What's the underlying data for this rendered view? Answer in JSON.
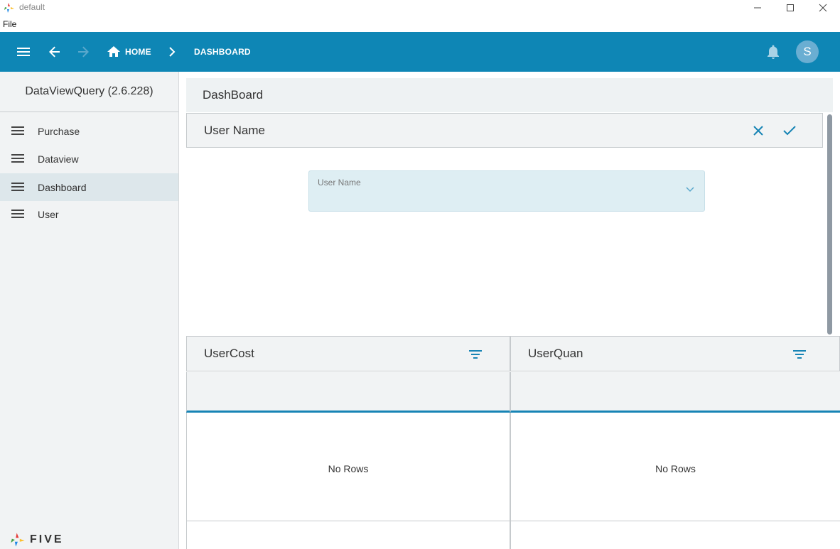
{
  "window": {
    "title": "default",
    "icons": [
      "five-logo-icon",
      "minimize-icon",
      "maximize-icon",
      "close-window-icon"
    ]
  },
  "menubar": {
    "file_label": "File"
  },
  "header": {
    "crumbs": {
      "home": "HOME",
      "current": "DASHBOARD"
    },
    "avatar_initial": "S",
    "icons": [
      "hamburger-menu-icon",
      "back-arrow-icon",
      "forward-arrow-icon",
      "home-icon",
      "chevron-right-icon",
      "bell-icon"
    ]
  },
  "sidebar": {
    "app_name": "DataViewQuery (2.6.228)",
    "items": [
      {
        "label": "Purchase"
      },
      {
        "label": "Dataview"
      },
      {
        "label": "Dashboard"
      },
      {
        "label": "User"
      }
    ],
    "active_index": 2,
    "brand": "FIVE"
  },
  "main": {
    "page_title": "DashBoard",
    "form": {
      "title": "User Name",
      "field_label": "User Name",
      "icons": [
        "cancel-x-icon",
        "check-icon",
        "chevron-down-icon"
      ]
    },
    "grids": [
      {
        "title": "UserCost",
        "empty_text": "No Rows"
      },
      {
        "title": "UserQuan",
        "empty_text": "No Rows"
      }
    ]
  },
  "colors": {
    "accent": "#0e86b5",
    "sidebar_bg": "#f1f3f4",
    "active_item": "#dde7eb",
    "field_bg": "#deeef3"
  }
}
